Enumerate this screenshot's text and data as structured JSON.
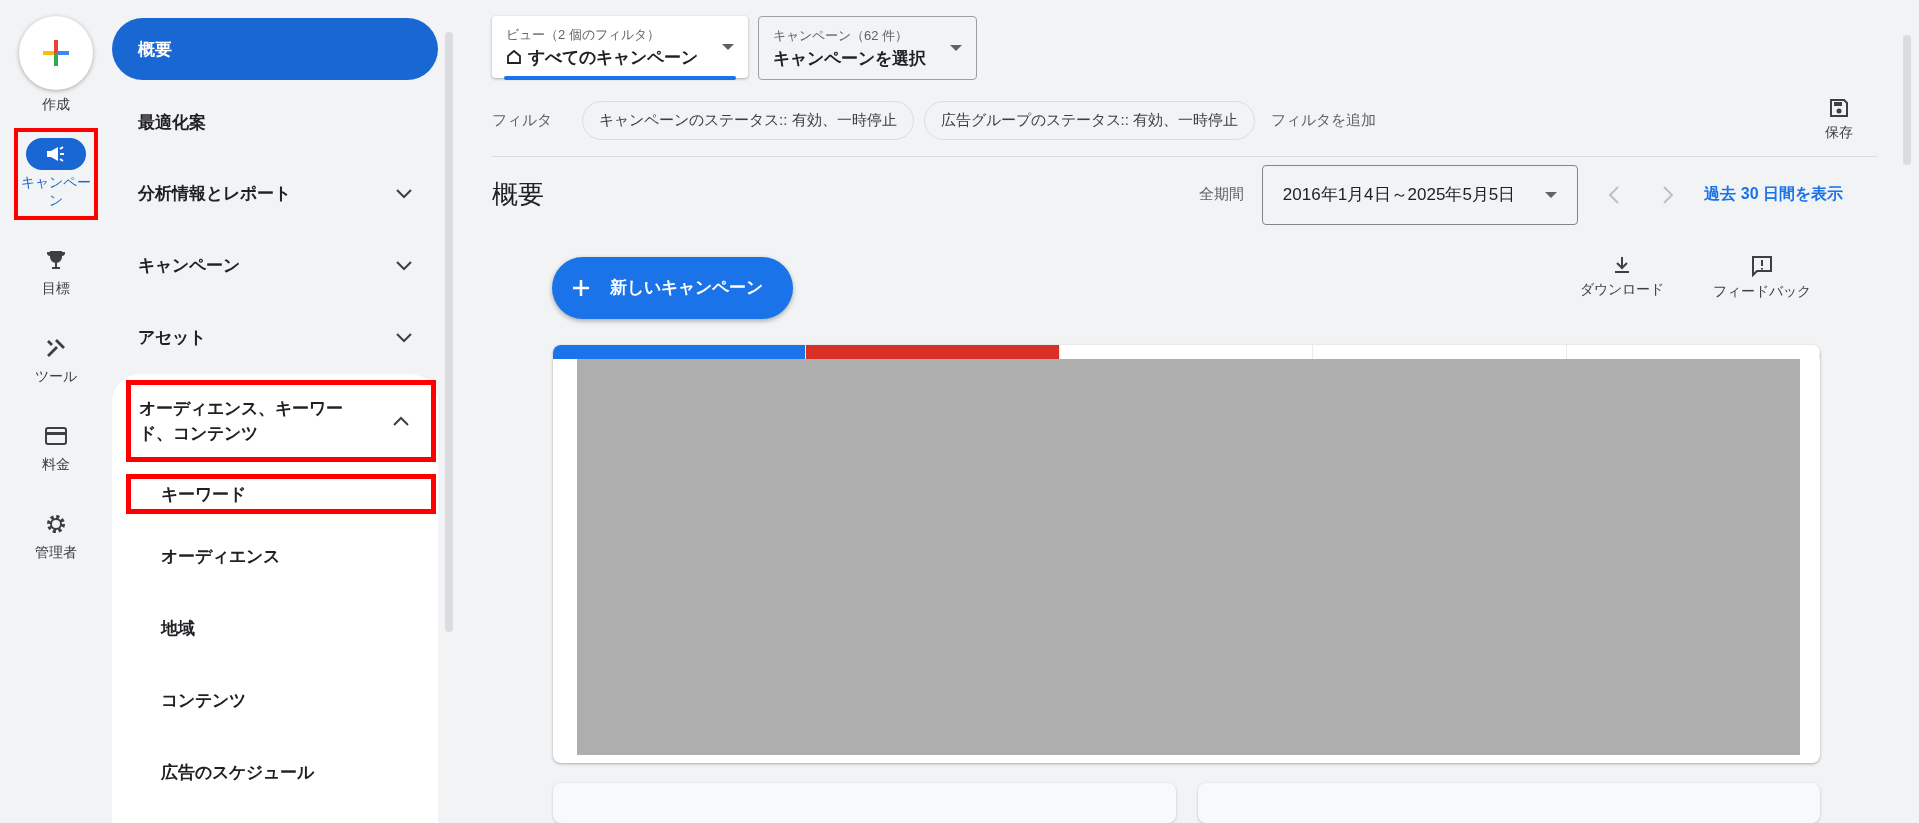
{
  "rail": {
    "create": {
      "label": "作成"
    },
    "items": [
      {
        "kind": "megaphone",
        "label": "キャンペーン",
        "selected": true,
        "highlighted": true
      },
      {
        "kind": "trophy",
        "label": "目標",
        "selected": false,
        "highlighted": false
      },
      {
        "kind": "tools",
        "label": "ツール",
        "selected": false,
        "highlighted": false
      },
      {
        "kind": "card",
        "label": "料金",
        "selected": false,
        "highlighted": false
      },
      {
        "kind": "gear",
        "label": "管理者",
        "selected": false,
        "highlighted": false
      }
    ]
  },
  "nav": {
    "items": [
      {
        "kind": "link",
        "label": "概要",
        "selected": true
      },
      {
        "kind": "link",
        "label": "最適化案",
        "selected": false
      },
      {
        "kind": "group",
        "label": "分析情報とレポート",
        "selected": false,
        "expanded": false,
        "highlighted": false
      },
      {
        "kind": "group",
        "label": "キャンペーン",
        "selected": false,
        "expanded": false,
        "highlighted": false
      },
      {
        "kind": "group",
        "label": "アセット",
        "selected": false,
        "expanded": false,
        "highlighted": false
      },
      {
        "kind": "group",
        "label": "オーディエンス、キーワード、コンテンツ",
        "selected": false,
        "expanded": true,
        "highlighted": true,
        "children": [
          {
            "label": "キーワード",
            "selected": false,
            "highlighted": true
          },
          {
            "label": "オーディエンス",
            "selected": false,
            "highlighted": false
          },
          {
            "label": "地域",
            "selected": false,
            "highlighted": false
          },
          {
            "label": "コンテンツ",
            "selected": false,
            "highlighted": false
          },
          {
            "label": "広告のスケジュール",
            "selected": false,
            "highlighted": false
          }
        ]
      }
    ]
  },
  "toolbar": {
    "view": {
      "label": "ビュー（2 個のフィルタ）",
      "value": "すべてのキャンペーン"
    },
    "campaign": {
      "label": "キャンペーン（62 件）",
      "value": "キャンペーンを選択"
    },
    "filter_label": "フィルタ",
    "filters": [
      "キャンペーンのステータス:: 有効、一時停止",
      "広告グループのステータス:: 有効、一時停止"
    ],
    "add_filter": "フィルタを追加",
    "save": "保存"
  },
  "overview": {
    "title": "概要",
    "period_label": "全期間",
    "date_range": "2016年1月4日～2025年5月5日",
    "recent_link": "過去 30 日間を表示",
    "new_campaign": "新しいキャンペーン",
    "download": "ダウンロード",
    "feedback": "フィードバック",
    "metric_tiles": [
      {
        "color": "#1a73e8"
      },
      {
        "color": "#d93025"
      },
      {
        "color": "#ffffff"
      },
      {
        "color": "#ffffff"
      },
      {
        "color": "#ffffff"
      }
    ]
  }
}
